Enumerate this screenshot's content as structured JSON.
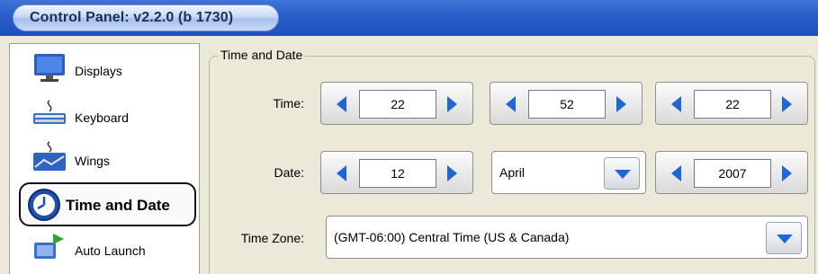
{
  "window": {
    "title": "Control Panel: v2.2.0 (b 1730)"
  },
  "sidebar": {
    "items": [
      {
        "label": "Displays",
        "icon": "monitor-icon"
      },
      {
        "label": "Keyboard",
        "icon": "keyboard-icon"
      },
      {
        "label": "Wings",
        "icon": "wings-icon"
      },
      {
        "label": "Time and Date",
        "icon": "clock-icon",
        "selected": true
      },
      {
        "label": "Auto Launch",
        "icon": "auto-launch-icon"
      }
    ]
  },
  "group": {
    "title": "Time and Date",
    "time": {
      "label": "Time:",
      "hour": "22",
      "minute": "52",
      "second": "22"
    },
    "date": {
      "label": "Date:",
      "day": "12",
      "month": "April",
      "year": "2007"
    },
    "timezone": {
      "label": "Time Zone:",
      "value": "(GMT-06:00) Central Time (US & Canada)"
    }
  },
  "colors": {
    "arrow": "#1f66d6",
    "titlebar": "#2a5cc9"
  }
}
